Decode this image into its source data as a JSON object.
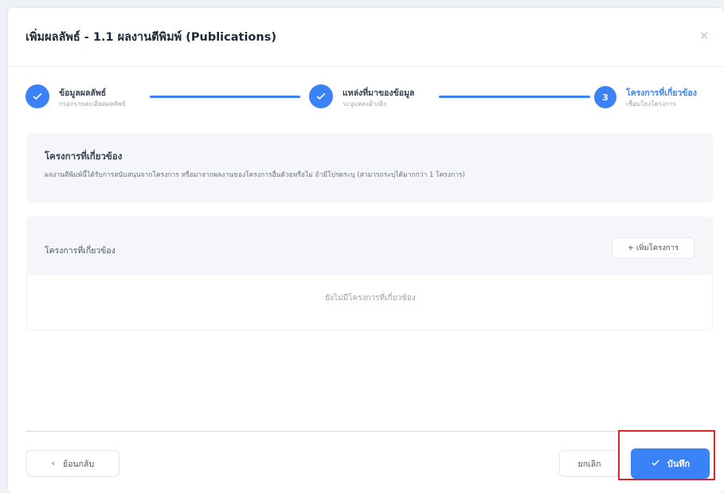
{
  "modal": {
    "title": "เพิ่มผลลัพธ์ - 1.1 ผลงานตีพิมพ์ (Publications)",
    "close_icon": "close-icon"
  },
  "stepper": {
    "steps": [
      {
        "title": "ข้อมูลผลลัพธ์",
        "subtitle": "กรอกรายละเอียดผลลัพธ์",
        "state": "completed",
        "icon": "check-icon"
      },
      {
        "title": "แหล่งที่มาของข้อมูล",
        "subtitle": "ระบุแหล่งอ้างอิง",
        "state": "completed",
        "icon": "check-icon"
      },
      {
        "title": "โครงการที่เกี่ยวข้อง",
        "subtitle": "เชื่อมโยงโครงการ",
        "state": "active",
        "number": "3"
      }
    ]
  },
  "info_panel": {
    "title": "โครงการที่เกี่ยวข้อง",
    "description": "ผลงานตีพิมพ์นี้ได้รับการสนับสนุนจากโครงการ หรือมาจากผลงานของโครงการอื่นด้วยหรือไม่ ถ้ามีโปรดระบุ (สามารถระบุได้มากกว่า 1 โครงการ)"
  },
  "projects_panel": {
    "header": "โครงการที่เกี่ยวข้อง",
    "add_button": "+ เพิ่มโครงการ",
    "empty_text": "ยังไม่มีโครงการที่เกี่ยวข้อง"
  },
  "footer": {
    "back_label": "ย้อนกลับ",
    "back_icon": "chevron-left-icon",
    "cancel_label": "ยกเลิก",
    "save_label": "บันทึก",
    "save_icon": "check-icon"
  },
  "colors": {
    "accent": "#3b82f6",
    "highlight": "#dc2626"
  }
}
